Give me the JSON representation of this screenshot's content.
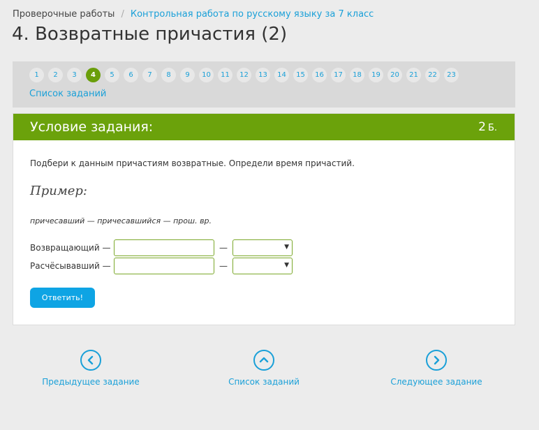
{
  "breadcrumb": {
    "parent": "Проверочные работы",
    "separator": "/",
    "current": "Контрольная работа по русскому языку за 7 класс"
  },
  "page_title": "4. Возвратные причастия (2)",
  "task_nav": {
    "numbers": [
      "1",
      "2",
      "3",
      "4",
      "5",
      "6",
      "7",
      "8",
      "9",
      "10",
      "11",
      "12",
      "13",
      "14",
      "15",
      "16",
      "17",
      "18",
      "19",
      "20",
      "21",
      "22",
      "23"
    ],
    "active": "4",
    "list_link": "Список заданий"
  },
  "card": {
    "title": "Условие задания:",
    "score_value": "2",
    "score_unit": "Б.",
    "instruction": "Подбери к данным причастиям возвратные. Определи время причастий.",
    "example_title": "Пример:",
    "example_text": "причесавший — причесавшийся — прош. вр.",
    "rows": [
      {
        "word": "Возвращающий —",
        "input_value": "",
        "dash": "—",
        "select_value": ""
      },
      {
        "word": "Расчёсывавший —",
        "input_value": "",
        "dash": "—",
        "select_value": ""
      }
    ],
    "submit_label": "Ответить!"
  },
  "bottom_nav": {
    "prev_label": "Предыдущее задание",
    "list_label": "Список заданий",
    "next_label": "Следующее задание"
  },
  "colors": {
    "accent_green": "#6ba20b",
    "link_blue": "#1aa0d8",
    "button_blue": "#0ea4e4"
  },
  "icons": {
    "prev": "chevron-left-circle-icon",
    "list": "chevron-up-circle-icon",
    "next": "chevron-right-circle-icon",
    "select_arrow": "caret-down-icon"
  }
}
